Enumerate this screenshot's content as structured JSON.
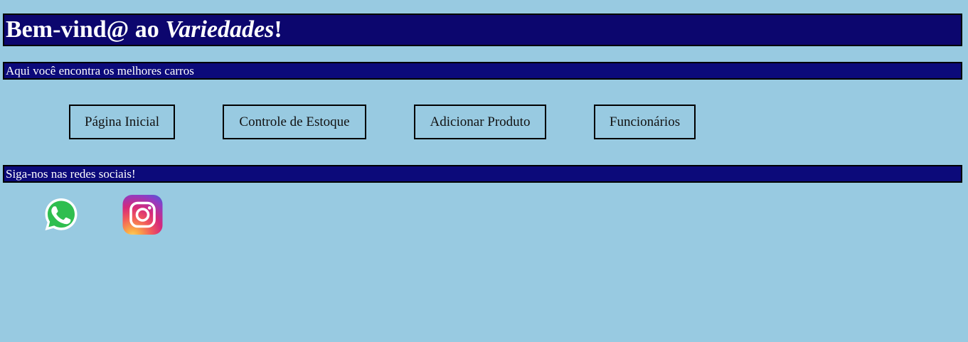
{
  "header": {
    "title_prefix": "Bem-vind@ ao ",
    "title_brand": "Variedades",
    "title_suffix": "!",
    "tagline": "Aqui você encontra os melhores carros"
  },
  "nav": {
    "home": "Página Inicial",
    "stock": "Controle de Estoque",
    "add_product": "Adicionar Produto",
    "employees": "Funcionários"
  },
  "social": {
    "heading": "Siga-nos nas redes sociais!",
    "icons": [
      "whatsapp-icon",
      "instagram-icon"
    ]
  },
  "colors": {
    "background": "#98cae1",
    "bar": "#0c066e",
    "whatsapp": "#25d366"
  }
}
